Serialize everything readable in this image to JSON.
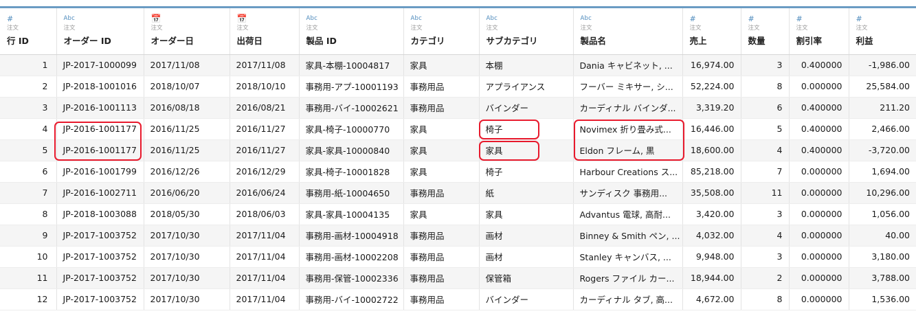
{
  "table": {
    "columns": [
      {
        "type_icon": "#",
        "type_class": "num",
        "source": "注文",
        "name": "行 ID",
        "align": "num"
      },
      {
        "type_icon": "Abc",
        "type_class": "abc",
        "source": "注文",
        "name": "オーダー ID",
        "align": "txt"
      },
      {
        "type_icon": "📅",
        "type_class": "cal",
        "source": "注文",
        "name": "オーダー日",
        "align": "txt"
      },
      {
        "type_icon": "📅",
        "type_class": "cal",
        "source": "注文",
        "name": "出荷日",
        "align": "txt"
      },
      {
        "type_icon": "Abc",
        "type_class": "abc",
        "source": "注文",
        "name": "製品 ID",
        "align": "txt"
      },
      {
        "type_icon": "Abc",
        "type_class": "abc",
        "source": "注文",
        "name": "カテゴリ",
        "align": "txt"
      },
      {
        "type_icon": "Abc",
        "type_class": "abc",
        "source": "注文",
        "name": "サブカテゴリ",
        "align": "txt"
      },
      {
        "type_icon": "Abc",
        "type_class": "abc",
        "source": "注文",
        "name": "製品名",
        "align": "txt"
      },
      {
        "type_icon": "#",
        "type_class": "num",
        "source": "注文",
        "name": "売上",
        "align": "num"
      },
      {
        "type_icon": "#",
        "type_class": "num",
        "source": "注文",
        "name": "数量",
        "align": "num"
      },
      {
        "type_icon": "#",
        "type_class": "num",
        "source": "注文",
        "name": "割引率",
        "align": "num"
      },
      {
        "type_icon": "#",
        "type_class": "num",
        "source": "注文",
        "name": "利益",
        "align": "num"
      }
    ],
    "rows": [
      [
        "1",
        "JP-2017-1000099",
        "2017/11/08",
        "2017/11/08",
        "家具-本棚-10004817",
        "家具",
        "本棚",
        "Dania キャビネット, ...",
        "16,974.00",
        "3",
        "0.400000",
        "-1,986.00"
      ],
      [
        "2",
        "JP-2018-1001016",
        "2018/10/07",
        "2018/10/10",
        "事務用-アプ-10001193",
        "事務用品",
        "アプライアンス",
        "フーバー ミキサー, シ...",
        "52,224.00",
        "8",
        "0.000000",
        "25,584.00"
      ],
      [
        "3",
        "JP-2016-1001113",
        "2016/08/18",
        "2016/08/21",
        "事務用-バイ-10002621",
        "事務用品",
        "バインダー",
        "カーディナル バインダ...",
        "3,319.20",
        "6",
        "0.400000",
        "211.20"
      ],
      [
        "4",
        "JP-2016-1001177",
        "2016/11/25",
        "2016/11/27",
        "家具-椅子-10000770",
        "家具",
        "椅子",
        "Novimex 折り畳み式...",
        "16,446.00",
        "5",
        "0.400000",
        "2,466.00"
      ],
      [
        "5",
        "JP-2016-1001177",
        "2016/11/25",
        "2016/11/27",
        "家具-家具-10000840",
        "家具",
        "家具",
        "Eldon フレーム, 黒",
        "18,600.00",
        "4",
        "0.400000",
        "-3,720.00"
      ],
      [
        "6",
        "JP-2016-1001799",
        "2016/12/26",
        "2016/12/29",
        "家具-椅子-10001828",
        "家具",
        "椅子",
        "Harbour Creations ス...",
        "85,218.00",
        "7",
        "0.000000",
        "1,694.00"
      ],
      [
        "7",
        "JP-2016-1002711",
        "2016/06/20",
        "2016/06/24",
        "事務用-紙-10004650",
        "事務用品",
        "紙",
        "サンディスク 事務用...",
        "35,508.00",
        "11",
        "0.000000",
        "10,296.00"
      ],
      [
        "8",
        "JP-2018-1003088",
        "2018/05/30",
        "2018/06/03",
        "家具-家具-10004135",
        "家具",
        "家具",
        "Advantus 電球, 高耐...",
        "3,420.00",
        "3",
        "0.000000",
        "1,056.00"
      ],
      [
        "9",
        "JP-2017-1003752",
        "2017/10/30",
        "2017/11/04",
        "事務用-画材-10004918",
        "事務用品",
        "画材",
        "Binney & Smith ペン, ...",
        "4,032.00",
        "4",
        "0.000000",
        "40.00"
      ],
      [
        "10",
        "JP-2017-1003752",
        "2017/10/30",
        "2017/11/04",
        "事務用-画材-10002208",
        "事務用品",
        "画材",
        "Stanley キャンバス, ...",
        "9,948.00",
        "3",
        "0.000000",
        "3,180.00"
      ],
      [
        "11",
        "JP-2017-1003752",
        "2017/10/30",
        "2017/11/04",
        "事務用-保管-10002336",
        "事務用品",
        "保管箱",
        "Rogers ファイル カー...",
        "18,944.00",
        "2",
        "0.000000",
        "3,788.00"
      ],
      [
        "12",
        "JP-2017-1003752",
        "2017/10/30",
        "2017/11/04",
        "事務用-バイ-10002722",
        "事務用品",
        "バインダー",
        "カーディナル タブ, 高...",
        "4,672.00",
        "8",
        "0.000000",
        "1,536.00"
      ]
    ]
  },
  "colors": {
    "header_accent": "#6a9bc3",
    "type_icon": "#4f8bbd",
    "highlight": "#e8192c",
    "row_alt": "#f5f5f5"
  }
}
